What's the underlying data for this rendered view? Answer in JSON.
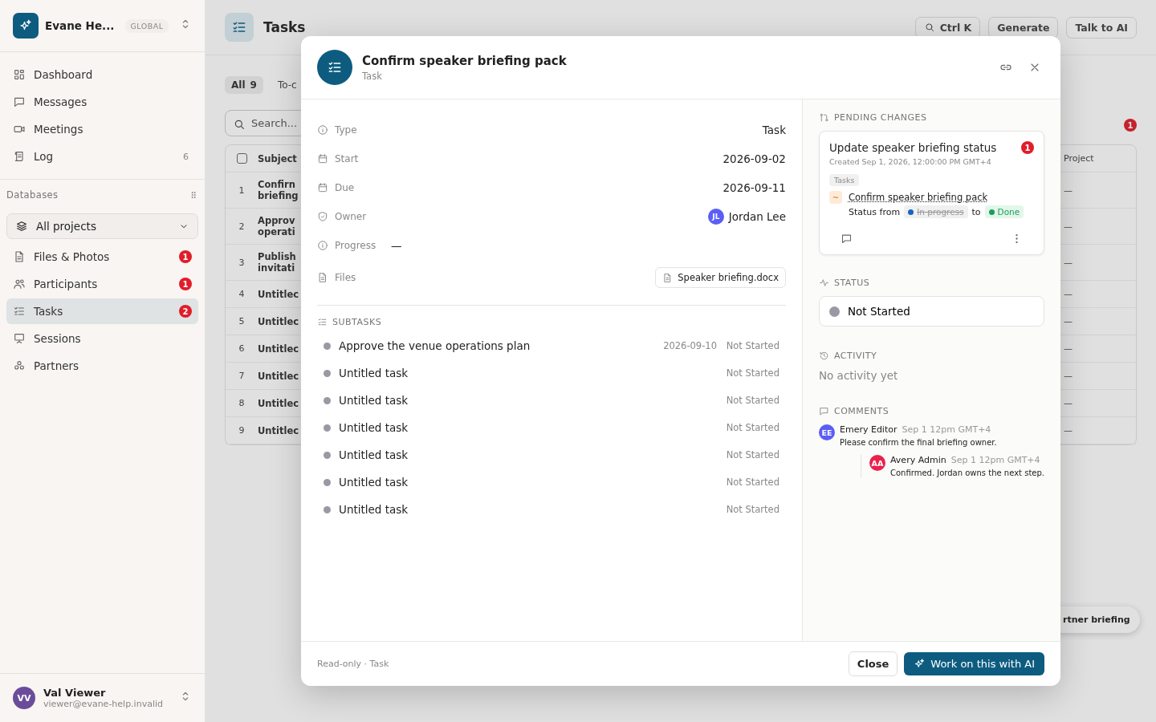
{
  "sidebar": {
    "workspace": {
      "name": "Evane He...",
      "scope": "GLOBAL"
    },
    "nav": [
      {
        "label": "Dashboard",
        "selected": false
      },
      {
        "label": "Messages",
        "selected": false
      },
      {
        "label": "Meetings",
        "selected": false
      },
      {
        "label": "Log",
        "count": "6",
        "selected": false
      }
    ],
    "databases_label": "Databases",
    "project_select": "All projects",
    "databases": [
      {
        "label": "Files & Photos",
        "badge": "1",
        "selected": false
      },
      {
        "label": "Participants",
        "badge": "1",
        "selected": false
      },
      {
        "label": "Tasks",
        "badge": "2",
        "selected": true
      },
      {
        "label": "Sessions",
        "selected": false
      },
      {
        "label": "Partners",
        "selected": false
      }
    ],
    "user": {
      "initials": "VV",
      "name": "Val Viewer",
      "email": "viewer@evane-help.invalid"
    }
  },
  "page": {
    "title": "Tasks",
    "shortcut": "Ctrl K",
    "generate": "Generate",
    "talk": "Talk to AI",
    "tabs": [
      {
        "label": "All",
        "count": "9",
        "selected": true
      },
      {
        "label": "To-c",
        "selected": false
      }
    ],
    "search": {
      "placeholder": "Search..."
    },
    "alert_badge": "1",
    "table": {
      "select_all_checked": false,
      "columns": [
        "Subject",
        "Project"
      ],
      "rows": [
        {
          "n": "1",
          "subject": [
            "Confirn",
            "briefing"
          ],
          "project": "—"
        },
        {
          "n": "2",
          "subject": [
            "Approv",
            "operati"
          ],
          "project": "—"
        },
        {
          "n": "3",
          "subject": [
            "Publish",
            "invitati"
          ],
          "project": "—"
        },
        {
          "n": "4",
          "subject": [
            "Untitlec"
          ],
          "project": "—"
        },
        {
          "n": "5",
          "subject": [
            "Untitlec"
          ],
          "project": "—"
        },
        {
          "n": "6",
          "subject": [
            "Untitlec"
          ],
          "project": "—"
        },
        {
          "n": "7",
          "subject": [
            "Untitlec"
          ],
          "project": "—"
        },
        {
          "n": "8",
          "subject": [
            "Untitlec"
          ],
          "project": "—"
        },
        {
          "n": "9",
          "subject": [
            "Untitlec"
          ],
          "project": "—"
        }
      ]
    },
    "floating_chip": "rtner briefing"
  },
  "modal": {
    "title": "Confirm speaker briefing pack",
    "subtitle": "Task",
    "fields": [
      {
        "label": "Type",
        "kind": "text",
        "value": "Task"
      },
      {
        "label": "Start",
        "kind": "text",
        "value": "2026-09-02"
      },
      {
        "label": "Due",
        "kind": "text",
        "value": "2026-09-11"
      },
      {
        "label": "Owner",
        "kind": "person",
        "initials": "JL",
        "value": "Jordan Lee"
      },
      {
        "label": "Progress",
        "kind": "inline",
        "value": "—"
      },
      {
        "label": "Files",
        "kind": "file",
        "value": "Speaker briefing.docx"
      }
    ],
    "subtasks_label": "SUBTASKS",
    "subtasks": [
      {
        "title": "Approve the venue operations plan",
        "date": "2026-09-10",
        "status": "Not Started"
      },
      {
        "title": "Untitled task",
        "status": "Not Started"
      },
      {
        "title": "Untitled task",
        "status": "Not Started"
      },
      {
        "title": "Untitled task",
        "status": "Not Started"
      },
      {
        "title": "Untitled task",
        "status": "Not Started"
      },
      {
        "title": "Untitled task",
        "status": "Not Started"
      },
      {
        "title": "Untitled task",
        "status": "Not Started"
      }
    ],
    "pending": {
      "label": "PENDING CHANGES",
      "title": "Update speaker briefing status",
      "badge": "1",
      "created": "Created Sep 1, 2026, 12:00:00 PM GMT+4",
      "tag": "Tasks",
      "mark": "~",
      "target": "Confirm speaker briefing pack",
      "status_from_label": "Status from",
      "from": {
        "label": "In progress",
        "color": "#1565c0"
      },
      "to_label": "to",
      "to": {
        "label": "Done",
        "color": "#1e9e5a"
      }
    },
    "status": {
      "label": "STATUS",
      "value": "Not Started",
      "color": "#9a99a3"
    },
    "activity": {
      "label": "ACTIVITY",
      "empty": "No activity yet"
    },
    "comments": {
      "label": "COMMENTS",
      "items": [
        {
          "initials": "EE",
          "color": "#5b5ef5",
          "author": "Emery Editor",
          "time": "Sep 1 12pm GMT+4",
          "text": "Please confirm the final briefing owner.",
          "replies": [
            {
              "initials": "AA",
              "color": "#e8224d",
              "author": "Avery Admin",
              "time": "Sep 1 12pm GMT+4",
              "text": "Confirmed. Jordan owns the next step."
            }
          ]
        }
      ]
    },
    "footer": {
      "note": "Read-only · Task",
      "close": "Close",
      "ai": "Work on this with AI"
    }
  }
}
